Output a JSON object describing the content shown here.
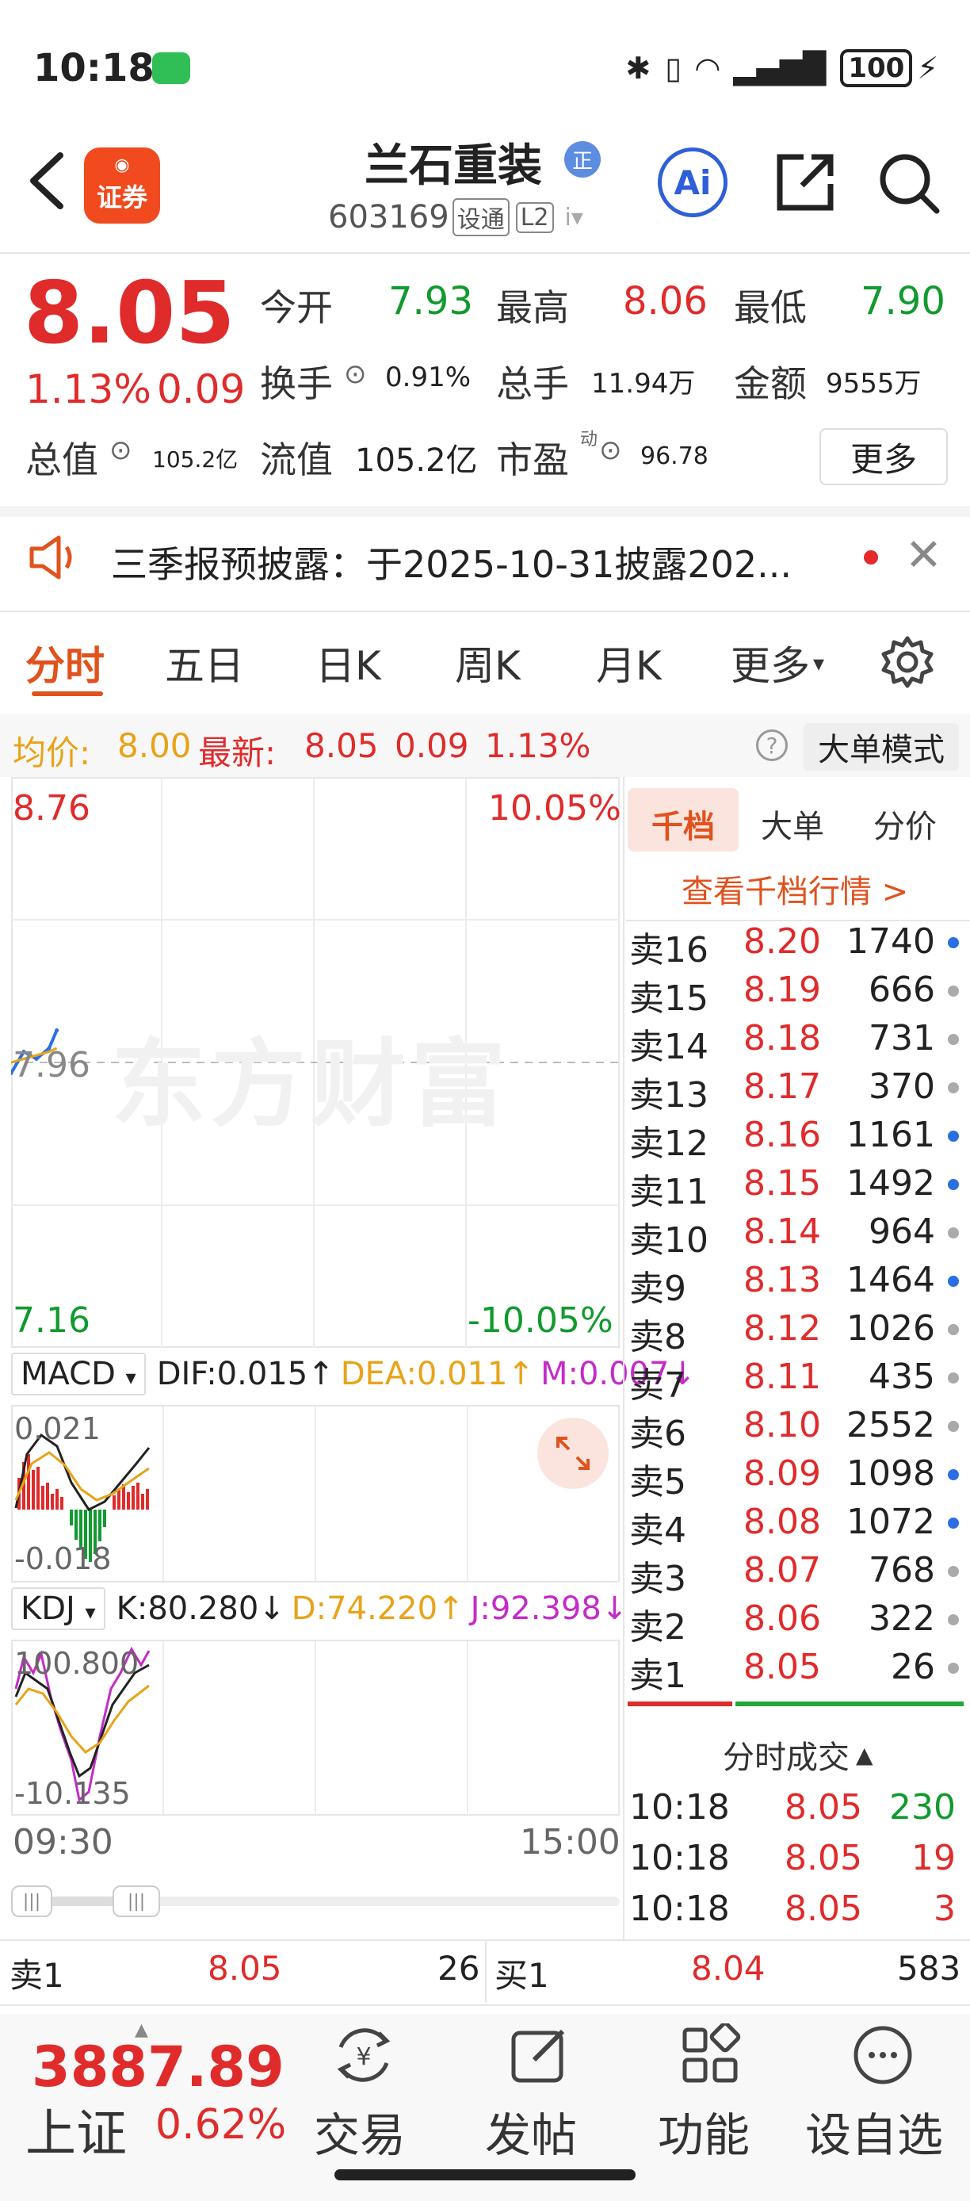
{
  "status_bar": {
    "time": "10:18",
    "battery": "100"
  },
  "header": {
    "back_icon": "chevron-left-icon",
    "app_logo_label": "证券",
    "stock_name": "兰石重装",
    "name_badge": "正",
    "stock_code": "603169",
    "code_tag1": "设通",
    "code_tag2": "L2",
    "ai_label": "Ai"
  },
  "quote": {
    "price": "8.05",
    "change_pct": "1.13%",
    "change_abs": "0.09",
    "open_label": "今开",
    "open": "7.93",
    "high_label": "最高",
    "high": "8.06",
    "low_label": "最低",
    "low": "7.90",
    "turnover_label": "换手",
    "turnover": "0.91%",
    "volume_label": "总手",
    "volume": "11.94万",
    "amount_label": "金额",
    "amount": "9555万",
    "mcap_label": "总值",
    "mcap": "105.2亿",
    "float_label": "流值",
    "float_mcap": "105.2亿",
    "pe_label": "市盈",
    "pe_sup": "动",
    "pe": "96.78",
    "more_label": "更多"
  },
  "notice": {
    "text": "三季报预披露：于2025-10-31披露202..."
  },
  "tabs": [
    "分时",
    "五日",
    "日K",
    "周K",
    "月K",
    "更多"
  ],
  "info_line": {
    "avg_label": "均价:",
    "avg_value": "8.00",
    "latest_label": "最新:",
    "latest_value": "8.05",
    "latest_chg": "0.09",
    "latest_pct": "1.13%",
    "big_order_label": "大单模式"
  },
  "chart": {
    "top_price": "8.76",
    "top_pct": "10.05%",
    "mid_price": "7.96",
    "bottom_price": "7.16",
    "bottom_pct": "-10.05%",
    "time_start": "09:30",
    "time_end": "15:00",
    "watermark": "东方财富"
  },
  "chart_data": {
    "type": "line",
    "x": [
      "09:30",
      "09:35",
      "09:40",
      "09:45",
      "09:48"
    ],
    "series": [
      {
        "values": [
          7.93,
          7.99,
          7.97,
          8.0,
          8.05
        ]
      }
    ],
    "ylim": [
      7.16,
      8.76
    ]
  },
  "macd": {
    "selector": "MACD",
    "dif": "DIF:0.015↑",
    "dea": "DEA:0.011↑",
    "m": "M:0.007↓",
    "top": "0.021",
    "bottom": "-0.018"
  },
  "kdj": {
    "selector": "KDJ",
    "k": "K:80.280↓",
    "d": "D:74.220↑",
    "j": "J:92.398↓",
    "top": "100.800",
    "bottom": "-10.135"
  },
  "order_book": {
    "tabs": [
      "千档",
      "大单",
      "分价"
    ],
    "link": "查看千档行情 >",
    "asks": [
      {
        "label": "卖16",
        "price": "8.20",
        "vol": "1740",
        "dot": "#2a6fe0"
      },
      {
        "label": "卖15",
        "price": "8.19",
        "vol": "666",
        "dot": "#aaaaaa"
      },
      {
        "label": "卖14",
        "price": "8.18",
        "vol": "731",
        "dot": "#aaaaaa"
      },
      {
        "label": "卖13",
        "price": "8.17",
        "vol": "370",
        "dot": "#aaaaaa"
      },
      {
        "label": "卖12",
        "price": "8.16",
        "vol": "1161",
        "dot": "#2a6fe0"
      },
      {
        "label": "卖11",
        "price": "8.15",
        "vol": "1492",
        "dot": "#2a6fe0"
      },
      {
        "label": "卖10",
        "price": "8.14",
        "vol": "964",
        "dot": "#aaaaaa"
      },
      {
        "label": "卖9",
        "price": "8.13",
        "vol": "1464",
        "dot": "#2a6fe0"
      },
      {
        "label": "卖8",
        "price": "8.12",
        "vol": "1026",
        "dot": "#aaaaaa"
      },
      {
        "label": "卖7",
        "price": "8.11",
        "vol": "435",
        "dot": "#aaaaaa"
      },
      {
        "label": "卖6",
        "price": "8.10",
        "vol": "2552",
        "dot": "#aaaaaa"
      },
      {
        "label": "卖5",
        "price": "8.09",
        "vol": "1098",
        "dot": "#2a6fe0"
      },
      {
        "label": "卖4",
        "price": "8.08",
        "vol": "1072",
        "dot": "#2a6fe0"
      },
      {
        "label": "卖3",
        "price": "8.07",
        "vol": "768",
        "dot": "#aaaaaa"
      },
      {
        "label": "卖2",
        "price": "8.06",
        "vol": "322",
        "dot": "#aaaaaa"
      },
      {
        "label": "卖1",
        "price": "8.05",
        "vol": "26",
        "dot": "#aaaaaa"
      }
    ],
    "trades_header": "分时成交",
    "trades": [
      {
        "time": "10:18",
        "price": "8.05",
        "vol": "230"
      },
      {
        "time": "10:18",
        "price": "8.05",
        "vol": "19"
      },
      {
        "time": "10:18",
        "price": "8.05",
        "vol": "3"
      }
    ]
  },
  "bid_ask": {
    "ask1_label": "卖1",
    "ask1_price": "8.05",
    "ask1_vol": "26",
    "bid1_label": "买1",
    "bid1_price": "8.04",
    "bid1_vol": "583"
  },
  "bottom_nav": {
    "index_value": "3887.89",
    "index_name": "上证",
    "index_pct": "0.62%",
    "items": [
      "交易",
      "发帖",
      "功能",
      "设自选"
    ]
  },
  "colors": {
    "up": "#e02b2b",
    "down": "#119a2e",
    "accent": "#e0521e",
    "avg": "#e8a319"
  }
}
